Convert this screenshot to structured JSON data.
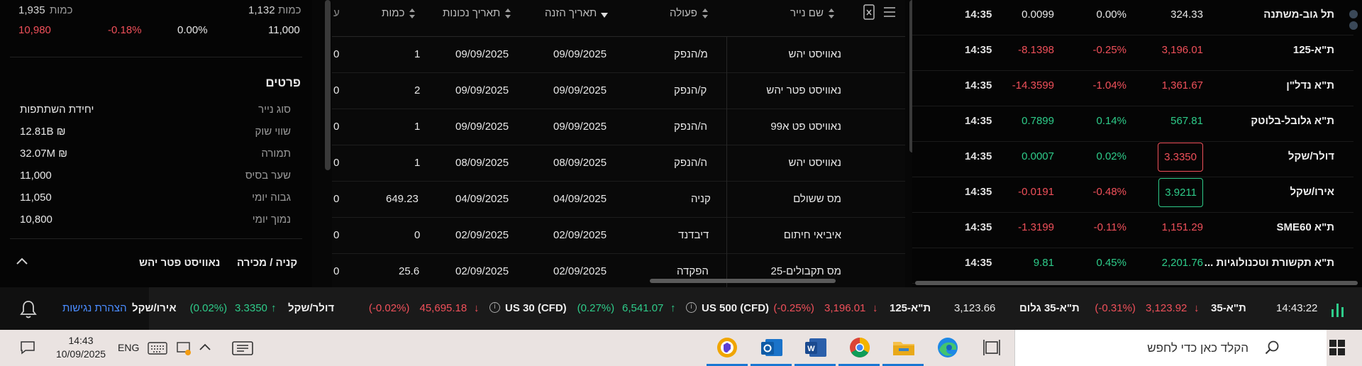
{
  "left_panel": {
    "top_row": {
      "qty_label_a": "כמות",
      "qty_a": "1,935",
      "qty_label_b": "כמות",
      "qty_b": "1,132"
    },
    "quote_row": {
      "price": "10,980",
      "change_pct": "-0.18%",
      "zero_pct": "0.00%",
      "base": "11,000"
    },
    "details_title": "פרטים",
    "details": [
      {
        "label": "סוג נייר",
        "value": "יחידת השתתפות"
      },
      {
        "label": "שווי שוק",
        "value": "₪ 12.81B"
      },
      {
        "label": "תמורה",
        "value": "₪ 32.07M"
      },
      {
        "label": "שער בסיס",
        "value": "11,000"
      },
      {
        "label": "גבוה יומי",
        "value": "11,050"
      },
      {
        "label": "נמוך יומי",
        "value": "10,800"
      }
    ],
    "footer": {
      "buy_sell": "קניה / מכירה",
      "security": "נאוויסט פטר יהש"
    }
  },
  "table": {
    "headers": {
      "name": "שם נייר",
      "action": "פעולה",
      "order_date": "תאריך הזנה",
      "value_date": "תאריך נכונות",
      "qty": "כמות",
      "cut": "ע"
    },
    "rows": [
      {
        "name": "נאוויסט יהש",
        "action": "מ/הנפק",
        "order_date": "09/09/2025",
        "value_date": "09/09/2025",
        "qty": "1",
        "cut": "0"
      },
      {
        "name": "נאוויסט פטר יהש",
        "action": "ק/הנפק",
        "order_date": "09/09/2025",
        "value_date": "09/09/2025",
        "qty": "2",
        "cut": "0"
      },
      {
        "name": "נאוויסט פט א99",
        "action": "ה/הנפק",
        "order_date": "09/09/2025",
        "value_date": "09/09/2025",
        "qty": "1",
        "cut": "0"
      },
      {
        "name": "נאוויסט יהש",
        "action": "ה/הנפק",
        "order_date": "08/09/2025",
        "value_date": "08/09/2025",
        "qty": "1",
        "cut": "0"
      },
      {
        "name": "מס ששולם",
        "action": "קניה",
        "order_date": "04/09/2025",
        "value_date": "04/09/2025",
        "qty": "649.23",
        "cut": "0"
      },
      {
        "name": "איביאי חיתום",
        "action": "דיבדנד",
        "order_date": "02/09/2025",
        "value_date": "02/09/2025",
        "qty": "0",
        "cut": "0"
      },
      {
        "name": "מס תקבולים-25",
        "action": "הפקדה",
        "order_date": "02/09/2025",
        "value_date": "02/09/2025",
        "qty": "25.6",
        "cut": "0"
      }
    ]
  },
  "market_list": [
    {
      "name": "תל גוב-משתנה",
      "value": "324.33",
      "pct": "0.00%",
      "change": "0.0099",
      "time": "14:35",
      "dir": "flat"
    },
    {
      "name": "ת\"א-125",
      "value": "3,196.01",
      "pct": "-0.25%",
      "change": "-8.1398",
      "time": "14:35",
      "dir": "neg"
    },
    {
      "name": "ת\"א נדל\"ן",
      "value": "1,361.67",
      "pct": "-1.04%",
      "change": "-14.3599",
      "time": "14:35",
      "dir": "neg"
    },
    {
      "name": "ת\"א גלובל-בלוטק",
      "value": "567.81",
      "pct": "0.14%",
      "change": "0.7899",
      "time": "14:35",
      "dir": "pos"
    },
    {
      "name": "דולר/שקל",
      "value": "3.3350",
      "pct": "0.02%",
      "change": "0.0007",
      "time": "14:35",
      "dir": "pos",
      "boxed": "neg"
    },
    {
      "name": "אירו/שקל",
      "value": "3.9211",
      "pct": "-0.48%",
      "change": "-0.0191",
      "time": "14:35",
      "dir": "neg",
      "boxed": "pos"
    },
    {
      "name": "ת\"א SME60",
      "value": "1,151.29",
      "pct": "-0.11%",
      "change": "-1.3199",
      "time": "14:35",
      "dir": "neg"
    },
    {
      "name": "ת\"א תקשורת וטכנולוגיות ...",
      "value": "2,201.76",
      "pct": "0.45%",
      "change": "9.81",
      "time": "14:35",
      "dir": "pos"
    }
  ],
  "ticker_bar": {
    "time": "14:43:22",
    "items": [
      {
        "label": "ת\"א-35",
        "value": "3,123.92",
        "pct": "(-0.31%)",
        "dir": "neg"
      },
      {
        "label": "ת\"א-35 גלום",
        "value": "3,123.66",
        "pct": "",
        "dir": "flat"
      },
      {
        "label": "ת\"א-125",
        "value": "3,196.01",
        "pct": "(-0.25%)",
        "dir": "neg"
      },
      {
        "label": "US 500 (CFD)",
        "value": "6,541.07",
        "pct": "(0.27%)",
        "dir": "pos"
      },
      {
        "label": "US 30 (CFD)",
        "value": "45,695.18",
        "pct": "(-0.02%)",
        "dir": "neg"
      },
      {
        "label": "דולר/שקל",
        "value": "3.3350",
        "pct": "(0.02%)",
        "dir": "pos"
      },
      {
        "label": "אירו/שקל",
        "value": "",
        "pct": "",
        "dir": "flat"
      }
    ],
    "accessibility": "הצהרת נגישות"
  },
  "taskbar": {
    "search_placeholder": "הקלד כאן כדי לחפש",
    "lang": "ENG",
    "clock_time": "14:43",
    "clock_date": "10/09/2025"
  },
  "colors": {
    "negative": "#f0505a",
    "positive": "#2ecc8a",
    "accent": "#4a8cff"
  }
}
